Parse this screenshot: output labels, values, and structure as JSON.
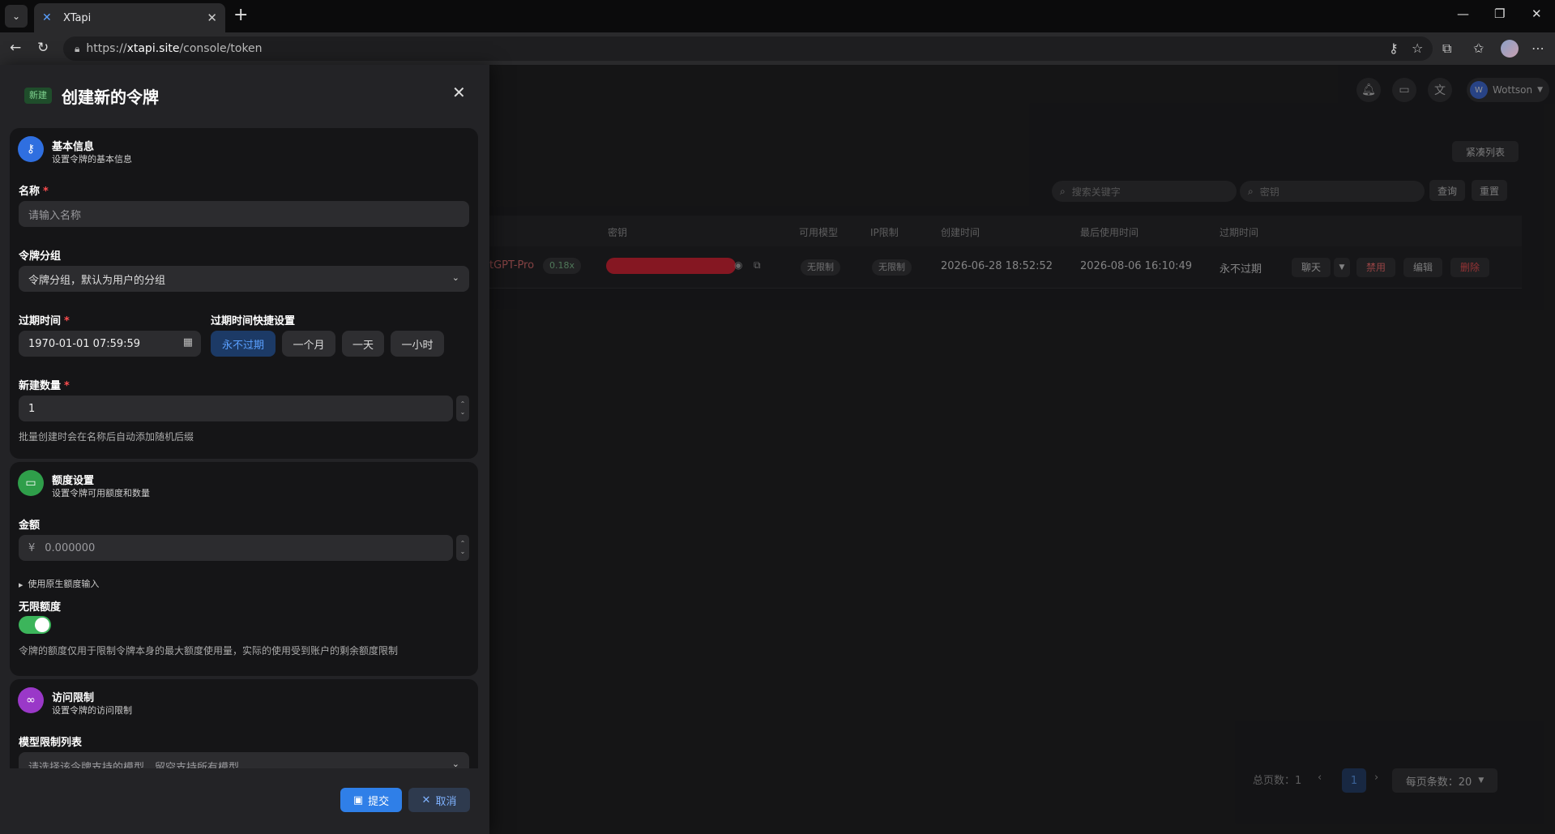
{
  "browser": {
    "tab_title": "XTapi",
    "url_prefix": "https://",
    "url_host": "xtapi.site",
    "url_path": "/console/token"
  },
  "header": {
    "user_initial": "W",
    "user_name": "Wottson"
  },
  "list": {
    "compact_label": "紧凑列表",
    "search_placeholder": "搜索关键字",
    "key_placeholder": "密钥",
    "query_label": "查询",
    "reset_label": "重置",
    "columns": [
      "密钥",
      "可用模型",
      "IP限制",
      "创建时间",
      "最后使用时间",
      "过期时间"
    ],
    "row": {
      "group": "tGPT-Pro",
      "ratio": "0.18x",
      "models": "无限制",
      "ip": "无限制",
      "created": "2026-06-28 18:52:52",
      "last_used": "2026-08-06 16:10:49",
      "expires": "永不过期",
      "chat": "聊天",
      "disable": "禁用",
      "edit": "编辑",
      "delete": "删除"
    },
    "pager": {
      "total": "总页数：1",
      "current": "1",
      "per_page": "每页条数：20"
    }
  },
  "sheet": {
    "badge": "新建",
    "title": "创建新的令牌",
    "basic": {
      "title": "基本信息",
      "subtitle": "设置令牌的基本信息",
      "name_label": "名称",
      "name_placeholder": "请输入名称",
      "group_label": "令牌分组",
      "group_placeholder": "令牌分组，默认为用户的分组",
      "expire_label": "过期时间",
      "expire_value": "1970-01-01 07:59:59",
      "quick_label": "过期时间快捷设置",
      "quick": [
        "永不过期",
        "一个月",
        "一天",
        "一小时"
      ],
      "count_label": "新建数量",
      "count_value": "1",
      "count_help": "批量创建时会在名称后自动添加随机后缀"
    },
    "quota": {
      "title": "额度设置",
      "subtitle": "设置令牌可用额度和数量",
      "amount_label": "金额",
      "currency": "¥",
      "amount_placeholder": "0.000000",
      "raw_toggle": "使用原生额度输入",
      "unlimited_label": "无限额度",
      "unlimited_on": true,
      "help": "令牌的额度仅用于限制令牌本身的最大额度使用量，实际的使用受到账户的剩余额度限制"
    },
    "access": {
      "title": "访问限制",
      "subtitle": "设置令牌的访问限制",
      "models_label": "模型限制列表",
      "models_placeholder": "请选择该令牌支持的模型，留空支持所有模型"
    },
    "submit": "提交",
    "cancel": "取消"
  },
  "colors": {
    "primary": "#5aa0ff",
    "success": "#3cb55b",
    "danger": "#ff4d4f",
    "redact": "#e21a2c"
  }
}
